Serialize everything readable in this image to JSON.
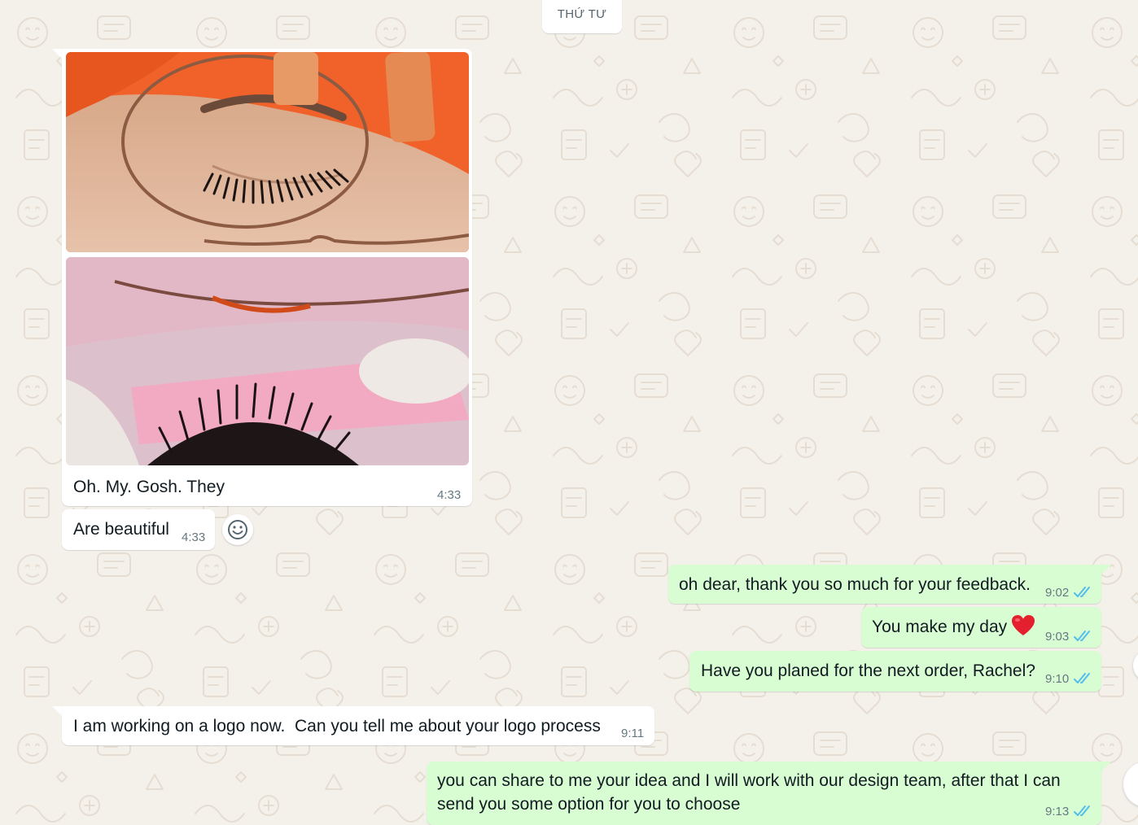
{
  "chat": {
    "date_separator": "THỨ TƯ",
    "messages": [
      {
        "direction": "in",
        "type": "image_group",
        "caption": "Oh. My. Gosh. They",
        "time": "4:33"
      },
      {
        "direction": "in",
        "type": "text",
        "text": "Are beautiful",
        "time": "4:33"
      },
      {
        "direction": "out",
        "type": "text",
        "text": "oh dear, thank you so much for your feedback.",
        "time": "9:02",
        "status": "read"
      },
      {
        "direction": "out",
        "type": "text",
        "text": "You make my day",
        "emoji": "heart",
        "time": "9:03",
        "status": "read"
      },
      {
        "direction": "out",
        "type": "text",
        "text": "Have you planed for the next order, Rachel?",
        "time": "9:10",
        "status": "read"
      },
      {
        "direction": "in",
        "type": "text",
        "text": "I am working on a logo now.  Can you tell me about your logo process",
        "time": "9:11"
      },
      {
        "direction": "out",
        "type": "text",
        "lines": [
          "you can share to me your idea and I will work with our design team, after that I can",
          "send you some option for you to choose"
        ],
        "time": "9:13",
        "status": "read"
      }
    ]
  },
  "icons": {
    "react": "smiley-icon",
    "read_status": "double-check-icon",
    "heart": "red-heart-emoji"
  },
  "colors": {
    "wallpaper": "#f4f1eb",
    "incoming_bubble": "#ffffff",
    "outgoing_bubble": "#d9fdd3",
    "read_ticks": "#53bdeb",
    "meta_text": "#667781"
  }
}
